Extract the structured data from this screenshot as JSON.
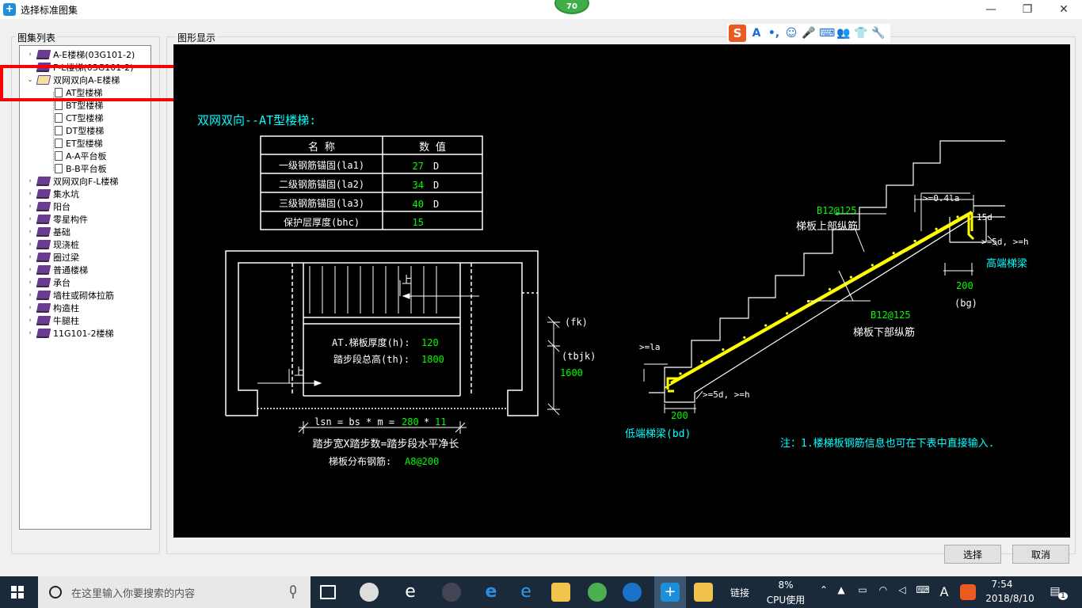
{
  "window": {
    "title": "选择标准图集",
    "minimize_glyph": "—",
    "maximize_glyph": "❐",
    "close_glyph": "✕"
  },
  "overlay_badge": "70",
  "tree_group_label": "图集列表",
  "canvas_group_label": "图形显示",
  "tree": [
    {
      "label": "A-E楼梯(03G101-2)",
      "type": "book",
      "expanded": false
    },
    {
      "label": "F-L楼梯(03G101-2)",
      "type": "book",
      "expanded": false
    },
    {
      "label": "双网双向A-E楼梯",
      "type": "book-open",
      "expanded": true
    },
    {
      "label": "AT型楼梯",
      "type": "doc",
      "selected": true
    },
    {
      "label": "BT型楼梯",
      "type": "doc"
    },
    {
      "label": "CT型楼梯",
      "type": "doc"
    },
    {
      "label": "DT型楼梯",
      "type": "doc"
    },
    {
      "label": "ET型楼梯",
      "type": "doc"
    },
    {
      "label": "A-A平台板",
      "type": "doc"
    },
    {
      "label": "B-B平台板",
      "type": "doc"
    },
    {
      "label": "双网双向F-L楼梯",
      "type": "book",
      "expanded": false
    },
    {
      "label": "集水坑",
      "type": "book",
      "expanded": false
    },
    {
      "label": "阳台",
      "type": "book",
      "expanded": false
    },
    {
      "label": "零星构件",
      "type": "book",
      "expanded": false
    },
    {
      "label": "基础",
      "type": "book",
      "expanded": false
    },
    {
      "label": "现浇桩",
      "type": "book",
      "expanded": false
    },
    {
      "label": "圈过梁",
      "type": "book",
      "expanded": false
    },
    {
      "label": "普通楼梯",
      "type": "book",
      "expanded": false
    },
    {
      "label": "承台",
      "type": "book",
      "expanded": false
    },
    {
      "label": "墙柱或砌体拉筋",
      "type": "book",
      "expanded": false
    },
    {
      "label": "构造柱",
      "type": "book",
      "expanded": false
    },
    {
      "label": "牛腿柱",
      "type": "book",
      "expanded": false
    },
    {
      "label": "11G101-2楼梯",
      "type": "book",
      "expanded": false
    }
  ],
  "ime_toolbar": {
    "logo": "S",
    "icons": [
      "A",
      "•,",
      "☺",
      "🎤",
      "⌨",
      "👥",
      "👕",
      "🔧"
    ]
  },
  "drawing": {
    "heading": "双网双向--AT型楼梯:",
    "table": {
      "headers": [
        "名  称",
        "数  值"
      ],
      "rows": [
        {
          "name": "一级钢筋锚固(la1)",
          "value": "27",
          "unit": "D"
        },
        {
          "name": "二级钢筋锚固(la2)",
          "value": "34",
          "unit": "D"
        },
        {
          "name": "三级钢筋锚固(la3)",
          "value": "40",
          "unit": "D"
        },
        {
          "name": "保护层厚度(bhc)",
          "value": "15",
          "unit": ""
        }
      ]
    },
    "plan": {
      "up_label_1": "上",
      "up_label_2": "上",
      "thickness_label": "AT.梯板厚度(h):",
      "thickness_value": "120",
      "height_label": "踏步段总高(th):",
      "height_value": "1800",
      "fk_label": "(fk)",
      "tbjk_label": "(tbjk)",
      "tbjk_value": "1600",
      "lsn_label": "lsn = bs * m =",
      "bs_value": "280",
      "times": "*",
      "m_value": "11",
      "caption": "踏步宽X踏步数=踏步段水平净长",
      "dist_label": "梯板分布钢筋:",
      "dist_value": "A8@200"
    },
    "section": {
      "top_bar_spec": "B12@125",
      "top_bar_label": "梯板上部纵筋",
      "bottom_bar_spec": "B12@125",
      "bottom_bar_label": "梯板下部纵筋",
      "anchor_top": ">=0.4la",
      "d15": "15d",
      "hook_top": ">=5d, >=h",
      "high_beam": "高端梯梁",
      "bg_value": "200",
      "bg_label": "(bg)",
      "la_label": ">=la",
      "hook_bottom": ">=5d, >=h",
      "bd_value": "200",
      "low_beam": "低端梯梁(bd)"
    },
    "note": "注：1.楼梯板钢筋信息也可在下表中直接输入."
  },
  "buttons": {
    "select": "选择",
    "cancel": "取消"
  },
  "taskbar": {
    "search_placeholder": "在这里输入你要搜索的内容",
    "link_label": "链接",
    "cpu_percent": "8%",
    "cpu_label": "CPU使用",
    "ime_letter": "A",
    "time": "7:54",
    "date": "2018/8/10",
    "notification_count": "1"
  }
}
